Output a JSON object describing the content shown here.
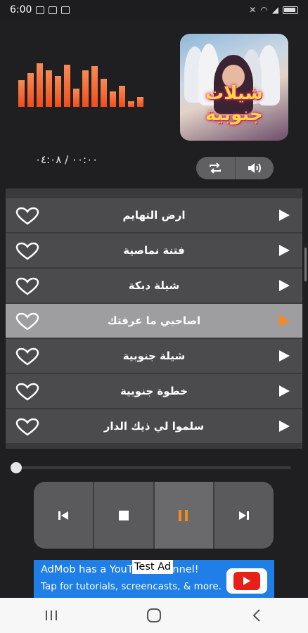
{
  "status": {
    "time": "6:00"
  },
  "player": {
    "album_title": "شيلات جنوبية",
    "elapsed": "٠٠:٠٠",
    "separator": "/",
    "duration": "٠٤:٠٨",
    "progress": 0
  },
  "playlist": [
    {
      "title": "ارض التهايم",
      "active": false
    },
    {
      "title": "فتنة نماصية",
      "active": false
    },
    {
      "title": "شيلة دبكة",
      "active": false
    },
    {
      "title": "اصاحبي ما عرفتك",
      "active": true
    },
    {
      "title": "شيلة جنوبية",
      "active": false
    },
    {
      "title": "خطوة جنوبية",
      "active": false
    },
    {
      "title": "سلموا لي ذيك الدار",
      "active": false
    }
  ],
  "ad": {
    "line1": "AdMob has a YouTube channel!",
    "line2": "Tap for tutorials, screencasts, & more.",
    "test_label": "Test Ad"
  },
  "colors": {
    "accent": "#f58a1f",
    "equalizer": "#f04d1c",
    "ad_bg": "#1f7fe6"
  }
}
